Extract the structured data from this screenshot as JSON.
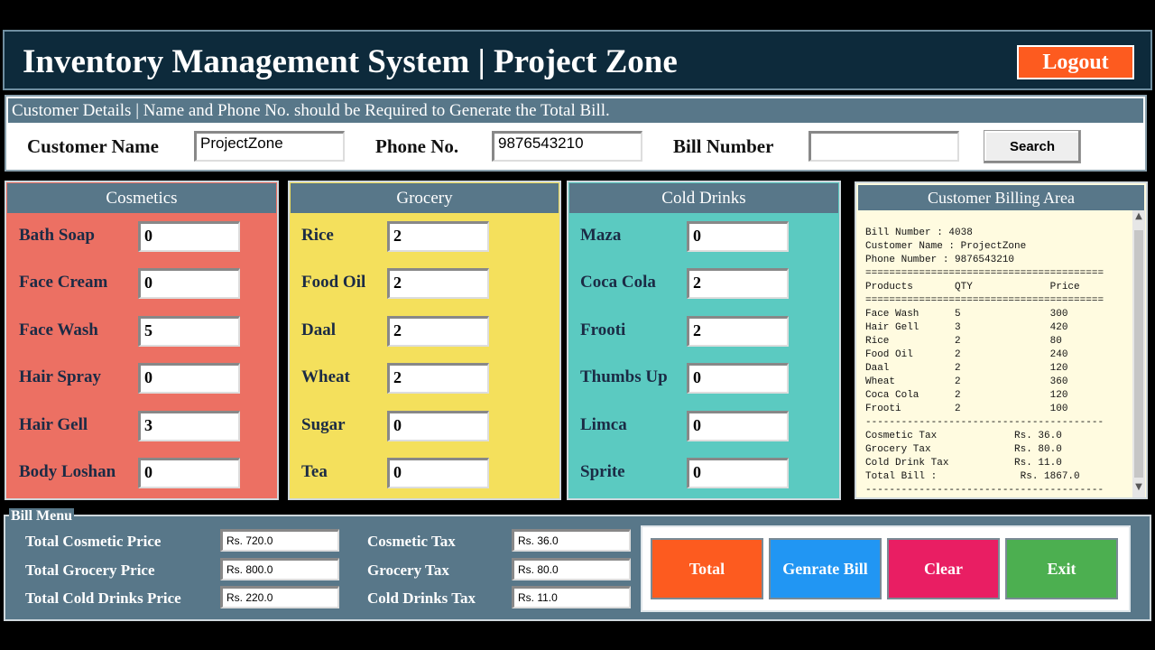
{
  "header": {
    "title": "Inventory Management System | Project Zone",
    "logout_label": "Logout"
  },
  "customer": {
    "bar_text": "Customer Details | Name and Phone No. should be Required to Generate the Total Bill.",
    "name_label": "Customer Name",
    "name_value": "ProjectZone",
    "phone_label": "Phone No.",
    "phone_value": "9876543210",
    "bill_label": "Bill Number",
    "bill_value": "",
    "search_label": "Search"
  },
  "cosmetics": {
    "title": "Cosmetics",
    "items": [
      {
        "label": "Bath Soap",
        "qty": "0"
      },
      {
        "label": "Face Cream",
        "qty": "0"
      },
      {
        "label": "Face Wash",
        "qty": "5"
      },
      {
        "label": "Hair Spray",
        "qty": "0"
      },
      {
        "label": "Hair Gell",
        "qty": "3"
      },
      {
        "label": "Body Loshan",
        "qty": "0"
      }
    ]
  },
  "grocery": {
    "title": "Grocery",
    "items": [
      {
        "label": "Rice",
        "qty": "2"
      },
      {
        "label": "Food Oil",
        "qty": "2"
      },
      {
        "label": "Daal",
        "qty": "2"
      },
      {
        "label": "Wheat",
        "qty": "2"
      },
      {
        "label": "Sugar",
        "qty": "0"
      },
      {
        "label": "Tea",
        "qty": "0"
      }
    ]
  },
  "cold_drinks": {
    "title": "Cold Drinks",
    "items": [
      {
        "label": "Maza",
        "qty": "0"
      },
      {
        "label": "Coca Cola",
        "qty": "2"
      },
      {
        "label": "Frooti",
        "qty": "2"
      },
      {
        "label": "Thumbs Up",
        "qty": "0"
      },
      {
        "label": "Limca",
        "qty": "0"
      },
      {
        "label": "Sprite",
        "qty": "0"
      }
    ]
  },
  "billing_area": {
    "title": "Customer Billing Area",
    "text": "Bill Number : 4038\nCustomer Name : ProjectZone\nPhone Number : 9876543210\n========================================\nProducts       QTY             Price\n========================================\nFace Wash      5               300\nHair Gell      3               420\nRice           2               80\nFood Oil       2               240\nDaal           2               120\nWheat          2               360\nCoca Cola      2               120\nFrooti         2               100\n----------------------------------------\nCosmetic Tax             Rs. 36.0\nGrocery Tax              Rs. 80.0\nCold Drink Tax           Rs. 11.0\nTotal Bill :              Rs. 1867.0\n----------------------------------------",
    "scroll_up_icon": "▲",
    "scroll_down_icon": "▼"
  },
  "bill_menu": {
    "legend": "Bill Menu",
    "total_cosmetic_label": "Total Cosmetic Price",
    "total_cosmetic_value": "Rs. 720.0",
    "total_grocery_label": "Total Grocery Price",
    "total_grocery_value": "Rs. 800.0",
    "total_cold_label": "Total Cold Drinks Price",
    "total_cold_value": "Rs. 220.0",
    "cosmetic_tax_label": "Cosmetic Tax",
    "cosmetic_tax_value": "Rs. 36.0",
    "grocery_tax_label": "Grocery Tax",
    "grocery_tax_value": "Rs. 80.0",
    "cold_tax_label": "Cold Drinks Tax",
    "cold_tax_value": "Rs. 11.0",
    "total_btn": "Total",
    "generate_btn": "Genrate Bill",
    "clear_btn": "Clear",
    "exit_btn": "Exit"
  },
  "colors": {
    "cosmetics_bg": "#ec7063",
    "grocery_bg": "#f4e05c",
    "cold_bg": "#5bcac1",
    "header_bg": "#0d2a3b",
    "bar_bg": "#587789",
    "total_btn": "#fd5b1f",
    "generate_btn": "#2196f3",
    "clear_btn": "#e91e63",
    "exit_btn": "#4caf50"
  }
}
